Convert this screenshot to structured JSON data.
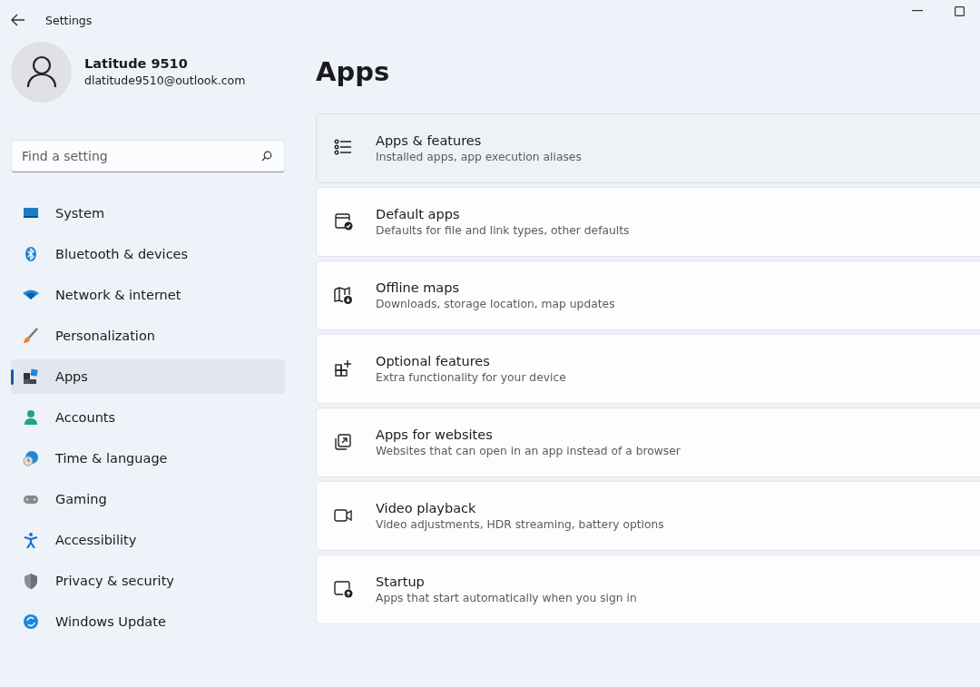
{
  "window": {
    "title": "Settings"
  },
  "account": {
    "name": "Latitude 9510",
    "email": "dlatitude9510@outlook.com"
  },
  "search": {
    "placeholder": "Find a setting"
  },
  "sidebar": {
    "items": [
      {
        "label": "System",
        "selected": false
      },
      {
        "label": "Bluetooth & devices",
        "selected": false
      },
      {
        "label": "Network & internet",
        "selected": false
      },
      {
        "label": "Personalization",
        "selected": false
      },
      {
        "label": "Apps",
        "selected": true
      },
      {
        "label": "Accounts",
        "selected": false
      },
      {
        "label": "Time & language",
        "selected": false
      },
      {
        "label": "Gaming",
        "selected": false
      },
      {
        "label": "Accessibility",
        "selected": false
      },
      {
        "label": "Privacy & security",
        "selected": false
      },
      {
        "label": "Windows Update",
        "selected": false
      }
    ]
  },
  "page": {
    "title": "Apps"
  },
  "cards": [
    {
      "title": "Apps & features",
      "subtitle": "Installed apps, app execution aliases",
      "hovered": true
    },
    {
      "title": "Default apps",
      "subtitle": "Defaults for file and link types, other defaults",
      "hovered": false
    },
    {
      "title": "Offline maps",
      "subtitle": "Downloads, storage location, map updates",
      "hovered": false
    },
    {
      "title": "Optional features",
      "subtitle": "Extra functionality for your device",
      "hovered": false
    },
    {
      "title": "Apps for websites",
      "subtitle": "Websites that can open in an app instead of a browser",
      "hovered": false
    },
    {
      "title": "Video playback",
      "subtitle": "Video adjustments, HDR streaming, battery options",
      "hovered": false
    },
    {
      "title": "Startup",
      "subtitle": "Apps that start automatically when you sign in",
      "hovered": false
    }
  ]
}
